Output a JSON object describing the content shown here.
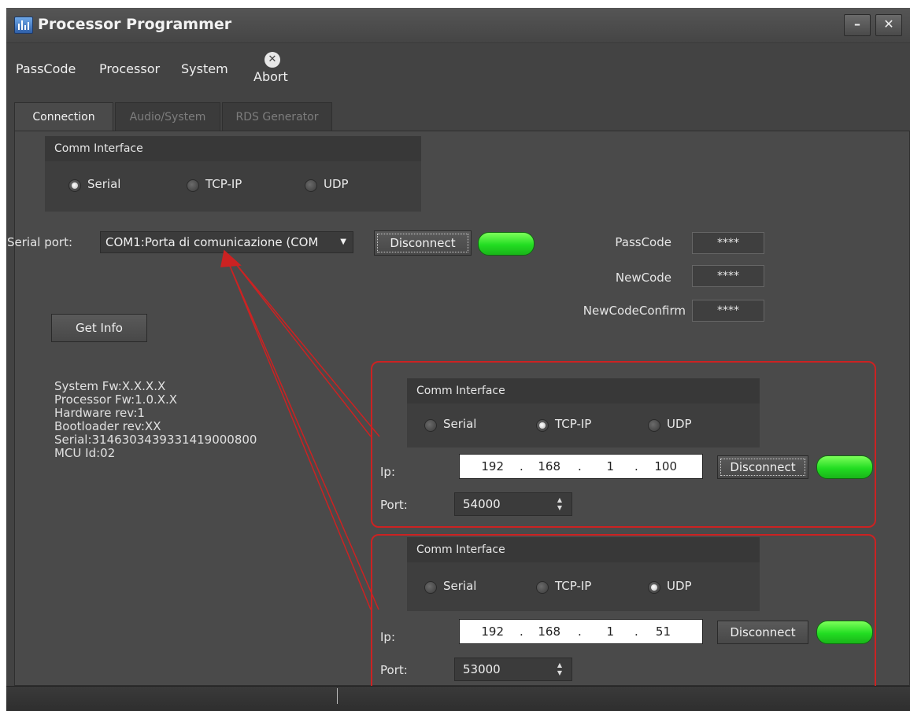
{
  "window": {
    "title": "Processor Programmer",
    "minimize_label": "–",
    "close_label": "✕"
  },
  "menu": {
    "items": [
      "PassCode",
      "Processor",
      "System"
    ],
    "abort_label": "Abort",
    "abort_icon": "abort-icon"
  },
  "tabs": [
    {
      "label": "Connection",
      "active": true
    },
    {
      "label": "Audio/System",
      "active": false
    },
    {
      "label": "RDS Generator",
      "active": false
    }
  ],
  "comm_interface": {
    "title": "Comm Interface",
    "options": [
      "Serial",
      "TCP-IP",
      "UDP"
    ],
    "selected": "Serial"
  },
  "serial": {
    "label": "Serial port:",
    "port_value": "COM1:Porta di comunicazione (COM",
    "disconnect_label": "Disconnect",
    "status_color": "#22dd22"
  },
  "passcodes": {
    "fields": [
      {
        "label": "PassCode",
        "value": "****"
      },
      {
        "label": "NewCode",
        "value": "****"
      },
      {
        "label": "NewCodeConfirm",
        "value": "****"
      }
    ]
  },
  "get_info_label": "Get Info",
  "info_lines": [
    "System Fw:X.X.X.X",
    "Processor Fw:1.0.X.X",
    "Hardware rev:1",
    "Bootloader rev:XX",
    "Serial:3146303439331419000800",
    "MCU Id:02"
  ],
  "tcp_panel": {
    "title": "Comm Interface",
    "options": [
      "Serial",
      "TCP-IP",
      "UDP"
    ],
    "selected": "TCP-IP",
    "ip_label": "Ip:",
    "ip": [
      "192",
      "168",
      "1",
      "100"
    ],
    "port_label": "Port:",
    "port": "54000",
    "disconnect_label": "Disconnect"
  },
  "udp_panel": {
    "title": "Comm Interface",
    "options": [
      "Serial",
      "TCP-IP",
      "UDP"
    ],
    "selected": "UDP",
    "ip_label": "Ip:",
    "ip": [
      "192",
      "168",
      "1",
      "51"
    ],
    "port_label": "Port:",
    "port": "53000",
    "disconnect_label": "Disconnect"
  },
  "annotation_color": "#cc2222"
}
